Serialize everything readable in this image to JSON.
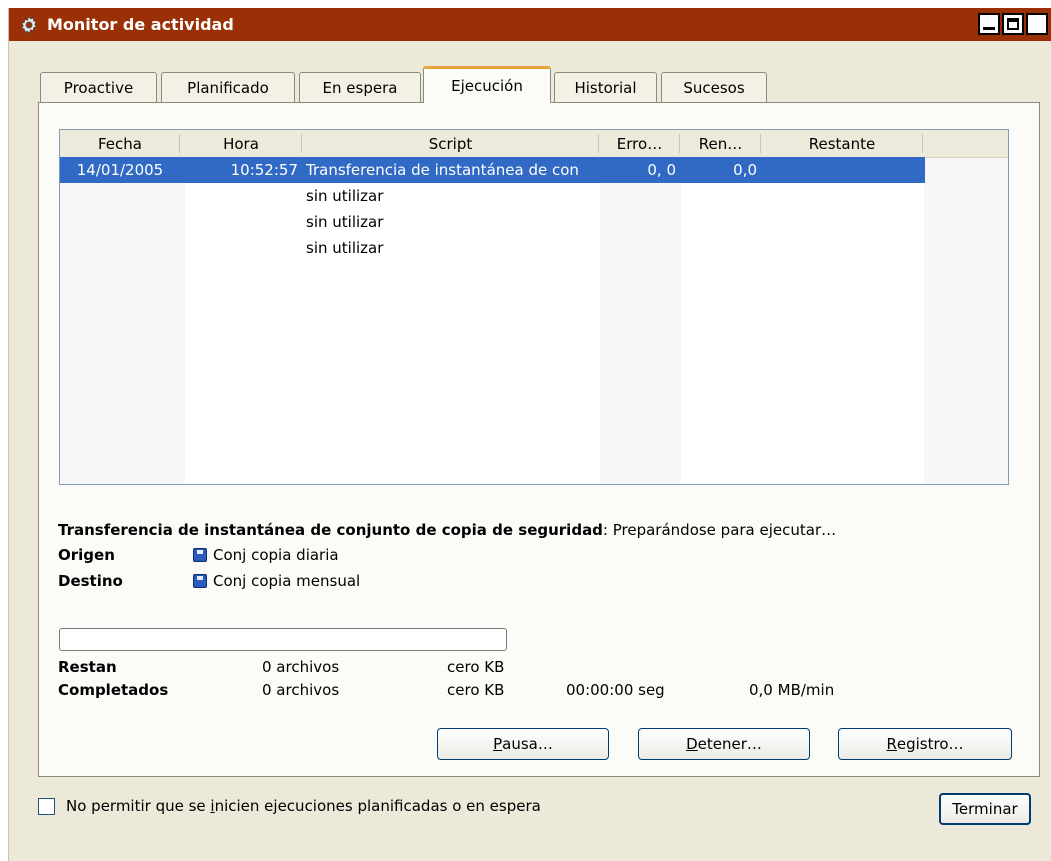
{
  "window": {
    "title": "Monitor de actividad",
    "buttons": {
      "minimize": "_",
      "maximize": "□",
      "close": "X"
    }
  },
  "tabs": [
    {
      "label": "Proactive"
    },
    {
      "label": "Planificado"
    },
    {
      "label": "En espera"
    },
    {
      "label": "Ejecución",
      "active": true
    },
    {
      "label": "Historial"
    },
    {
      "label": "Sucesos"
    }
  ],
  "list": {
    "columns": [
      "Fecha",
      "Hora",
      "Script",
      "Erro…",
      "Ren…",
      "Restante"
    ],
    "rows": [
      {
        "fecha": "14/01/2005",
        "hora": "10:52:57",
        "script": "Transferencia de instantánea de con",
        "errores": "0, 0",
        "rendimiento": "0,0",
        "restante": "",
        "selected": true
      },
      {
        "fecha": "",
        "hora": "",
        "script": "sin utilizar",
        "errores": "",
        "rendimiento": "",
        "restante": ""
      },
      {
        "fecha": "",
        "hora": "",
        "script": "sin utilizar",
        "errores": "",
        "rendimiento": "",
        "restante": ""
      },
      {
        "fecha": "",
        "hora": "",
        "script": "sin utilizar",
        "errores": "",
        "rendimiento": "",
        "restante": ""
      }
    ]
  },
  "status": {
    "job_name": "Transferencia de instantánea de conjunto de copia de seguridad",
    "job_state": ": Preparándose para ejecutar…",
    "origen_label": "Origen",
    "origen_value": "Conj copia diaria",
    "destino_label": "Destino",
    "destino_value": "Conj copia mensual",
    "progress_fraction": 0
  },
  "stats": {
    "restan_label": "Restan",
    "restan_files": "0 archivos",
    "restan_size": "cero KB",
    "completados_label": "Completados",
    "completados_files": "0 archivos",
    "completados_size": "cero KB",
    "completados_time": "00:00:00 seg",
    "completados_rate": "0,0 MB/min"
  },
  "actions": {
    "pausa_mnemonic": "P",
    "pausa_rest": "ausa…",
    "detener_mnemonic": "D",
    "detener_rest": "etener…",
    "registro_mnemonic": "R",
    "registro_rest": "egistro…"
  },
  "footer": {
    "checkbox_before": "No permitir que se ",
    "checkbox_mnemonic": "i",
    "checkbox_after": "nicien ejecuciones planificadas o en espera",
    "checkbox_checked": false,
    "terminar_label": "Terminar"
  }
}
